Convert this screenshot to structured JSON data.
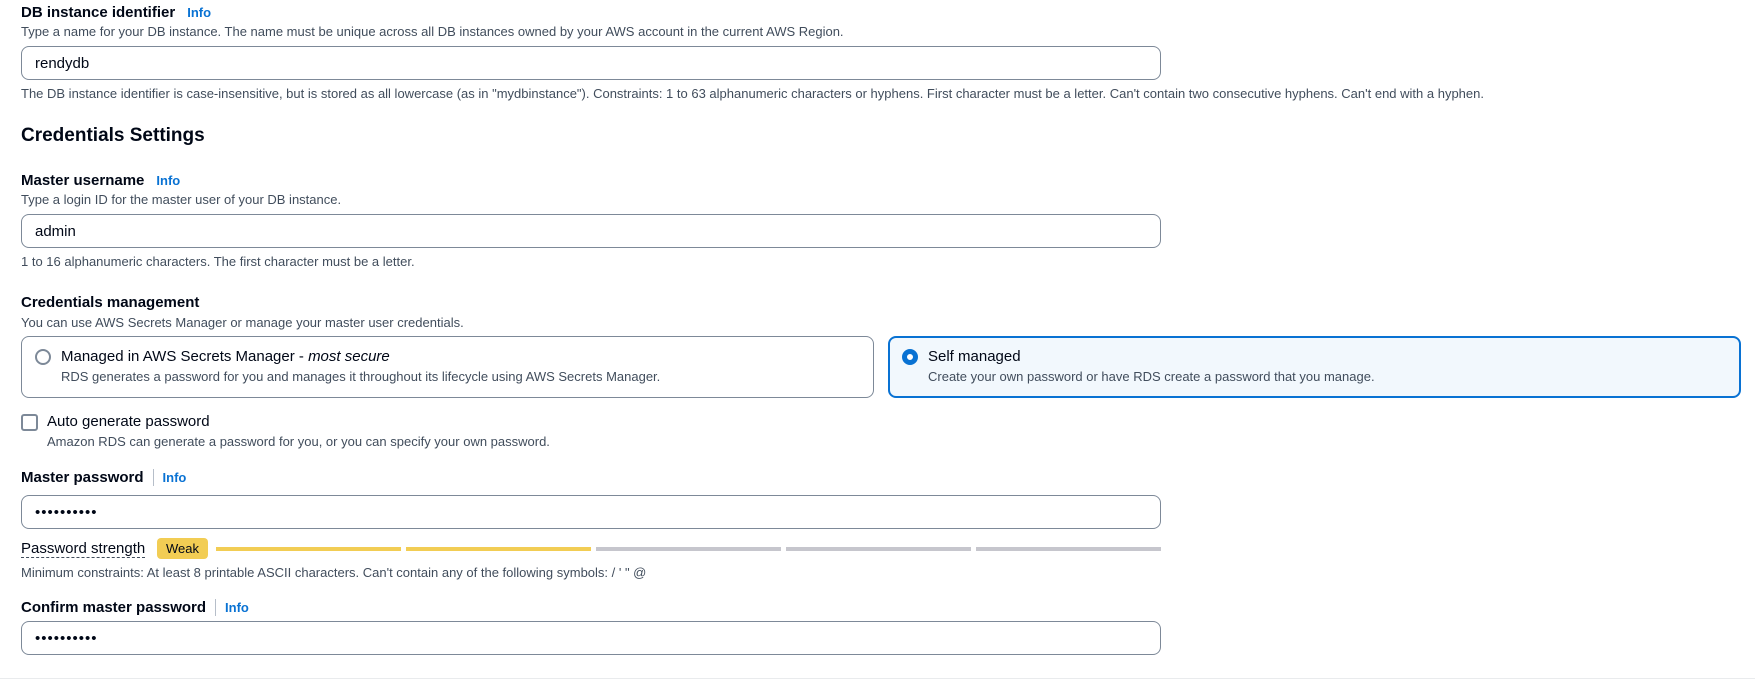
{
  "db_identifier": {
    "label": "DB instance identifier",
    "info": "Info",
    "description": "Type a name for your DB instance. The name must be unique across all DB instances owned by your AWS account in the current AWS Region.",
    "value": "rendydb",
    "constraint": "The DB instance identifier is case-insensitive, but is stored as all lowercase (as in \"mydbinstance\"). Constraints: 1 to 63 alphanumeric characters or hyphens. First character must be a letter. Can't contain two consecutive hyphens. Can't end with a hyphen."
  },
  "credentials": {
    "title": "Credentials Settings",
    "master_username": {
      "label": "Master username",
      "info": "Info",
      "description": "Type a login ID for the master user of your DB instance.",
      "value": "admin",
      "constraint": "1 to 16 alphanumeric characters. The first character must be a letter."
    },
    "management": {
      "label": "Credentials management",
      "description": "You can use AWS Secrets Manager or manage your master user credentials.",
      "options": [
        {
          "title": "Managed in AWS Secrets Manager - ",
          "title_emphasis": "most secure",
          "description": "RDS generates a password for you and manages it throughout its lifecycle using AWS Secrets Manager.",
          "selected": false
        },
        {
          "title": "Self managed",
          "description": "Create your own password or have RDS create a password that you manage.",
          "selected": true
        }
      ]
    },
    "auto_generate": {
      "label": "Auto generate password",
      "description": "Amazon RDS can generate a password for you, or you can specify your own password.",
      "checked": false
    },
    "master_password": {
      "label": "Master password",
      "info": "Info",
      "value": "••••••••••"
    },
    "password_strength": {
      "label": "Password strength",
      "badge": "Weak",
      "level": 2,
      "segments": 5,
      "badge_color": "#f2cd54",
      "constraint": "Minimum constraints: At least 8 printable ASCII characters. Can't contain any of the following symbols: / ' \" @"
    },
    "confirm_password": {
      "label": "Confirm master password",
      "info": "Info",
      "value": "••••••••••"
    }
  }
}
